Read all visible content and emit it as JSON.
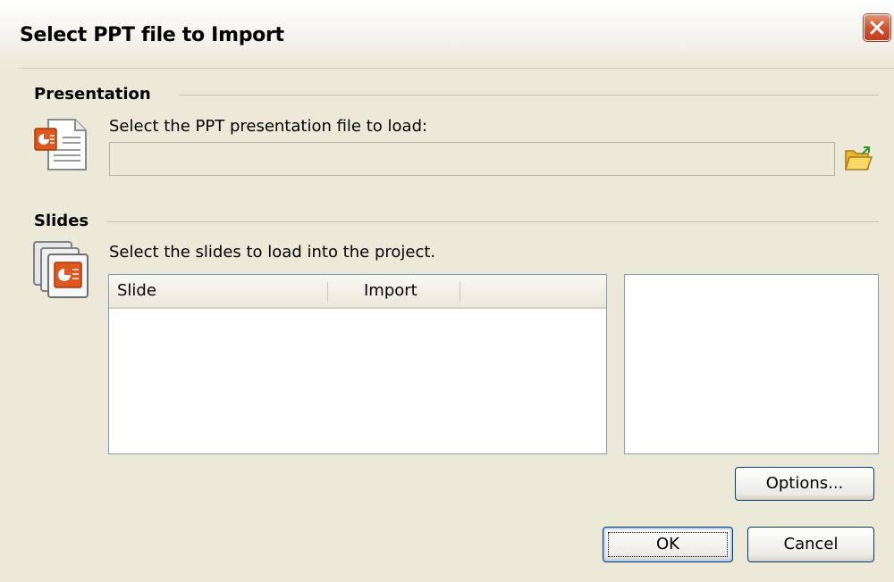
{
  "dialog": {
    "title": "Select PPT file to Import"
  },
  "presentation": {
    "section_label": "Presentation",
    "prompt": "Select the PPT presentation file to load:",
    "file_path": ""
  },
  "slides": {
    "section_label": "Slides",
    "prompt": "Select the slides to load into the project.",
    "columns": [
      "Slide",
      "Import"
    ],
    "rows": []
  },
  "buttons": {
    "options": "Options...",
    "ok": "OK",
    "cancel": "Cancel"
  },
  "icons": {
    "close": "close-icon",
    "ppt_file": "ppt-file-icon",
    "browse": "folder-open-icon",
    "slides": "slides-stack-icon"
  },
  "colors": {
    "dialog_bg": "#ece9d8",
    "close_red": "#d2532f",
    "ppt_orange": "#e0571b",
    "button_border": "#003c74"
  }
}
